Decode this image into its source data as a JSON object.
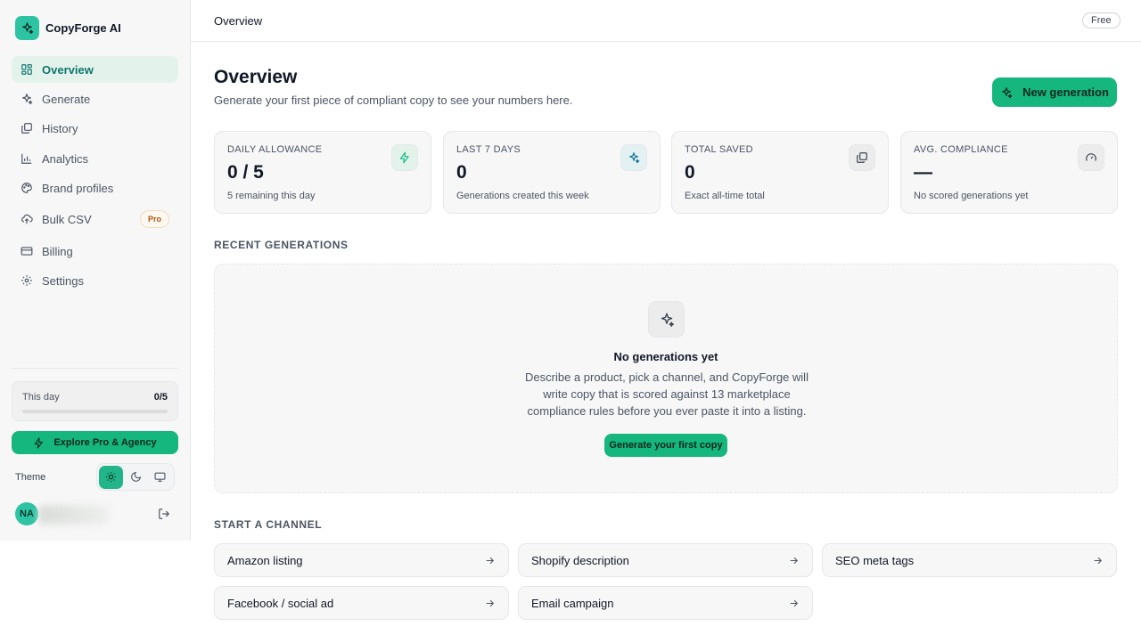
{
  "brand": {
    "name": "CopyForge AI",
    "logo_icon": "sparkles-icon",
    "accent": "#2ec4a3"
  },
  "sidebar": {
    "items": [
      {
        "label": "Overview",
        "icon": "grid-icon",
        "active": true
      },
      {
        "label": "Generate",
        "icon": "sparkles-icon"
      },
      {
        "label": "History",
        "icon": "layers-icon"
      },
      {
        "label": "Analytics",
        "icon": "bar-chart-icon"
      },
      {
        "label": "Brand profiles",
        "icon": "palette-icon"
      },
      {
        "label": "Bulk CSV",
        "icon": "upload-cloud-icon",
        "badge": "Pro"
      },
      {
        "label": "Billing",
        "icon": "credit-card-icon"
      },
      {
        "label": "Settings",
        "icon": "gear-icon"
      }
    ],
    "usage": {
      "label": "This day",
      "value": "0/5",
      "fraction": 0
    },
    "explore_label": "Explore Pro & Agency",
    "theme": {
      "label": "Theme",
      "options": [
        "light",
        "dark",
        "system"
      ],
      "selected": "light"
    },
    "user": {
      "initials": "NA"
    }
  },
  "header": {
    "title": "Overview",
    "plan": "Free"
  },
  "main": {
    "title": "Overview",
    "subtitle": "Generate your first piece of compliant copy to see your numbers here.",
    "new_button": "New generation",
    "stats": [
      {
        "label": "DAILY ALLOWANCE",
        "value": "0 / 5",
        "note": "5 remaining this day",
        "icon": "bolt-icon",
        "icon_bg": "#e3f3ec",
        "icon_color": "#10b981"
      },
      {
        "label": "LAST 7 DAYS",
        "value": "0",
        "note": "Generations created this week",
        "icon": "sparkles-icon",
        "icon_bg": "#e3f1f3",
        "icon_color": "#0e7490"
      },
      {
        "label": "TOTAL SAVED",
        "value": "0",
        "note": "Exact all-time total",
        "icon": "copy-icon",
        "icon_bg": "#ececec",
        "icon_color": "#374151"
      },
      {
        "label": "AVG. COMPLIANCE",
        "value": "—",
        "note": "No scored generations yet",
        "icon": "gauge-icon",
        "icon_bg": "#ececec",
        "icon_color": "#374151"
      }
    ],
    "recent": {
      "title": "RECENT GENERATIONS",
      "empty_title": "No generations yet",
      "empty_text": "Describe a product, pick a channel, and CopyForge will write copy that is scored against 13 marketplace compliance rules before you ever paste it into a listing.",
      "cta": "Generate your first copy"
    },
    "channels": {
      "title": "START A CHANNEL",
      "items": [
        "Amazon listing",
        "Shopify description",
        "SEO meta tags",
        "Facebook / social ad",
        "Email campaign"
      ]
    }
  }
}
